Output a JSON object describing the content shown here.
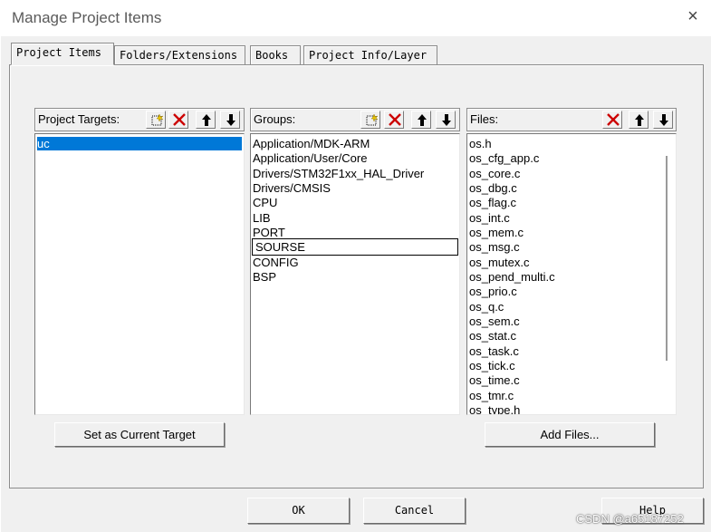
{
  "window": {
    "title": "Manage Project Items",
    "close_symbol": "×"
  },
  "tabs": [
    {
      "label": "Project Items",
      "active": true
    },
    {
      "label": "Folders/Extensions",
      "active": false
    },
    {
      "label": "Books",
      "active": false
    },
    {
      "label": "Project Info/Layer",
      "active": false
    }
  ],
  "targets": {
    "label": "Project Targets:",
    "items": [
      "uc"
    ],
    "selected": 0
  },
  "groups": {
    "label": "Groups:",
    "items": [
      "Application/MDK-ARM",
      "Application/User/Core",
      "Drivers/STM32F1xx_HAL_Driver",
      "Drivers/CMSIS",
      "CPU",
      "LIB",
      "PORT",
      "SOURSE",
      "CONFIG",
      "BSP"
    ],
    "focused": 7
  },
  "files": {
    "label": "Files:",
    "items": [
      "os.h",
      "os_cfg_app.c",
      "os_core.c",
      "os_dbg.c",
      "os_flag.c",
      "os_int.c",
      "os_mem.c",
      "os_msg.c",
      "os_mutex.c",
      "os_pend_multi.c",
      "os_prio.c",
      "os_q.c",
      "os_sem.c",
      "os_stat.c",
      "os_task.c",
      "os_tick.c",
      "os_time.c",
      "os_tmr.c",
      "os_type.h"
    ]
  },
  "buttons": {
    "set_current": "Set as Current Target",
    "add_files": "Add Files...",
    "ok": "OK",
    "cancel": "Cancel",
    "help": "Help"
  },
  "watermark": "CSDN @a65187252",
  "icons": {
    "new": "new-item-icon",
    "delete": "delete-icon",
    "up": "move-up-icon",
    "down": "move-down-icon"
  },
  "colors": {
    "selection": "#0078d7",
    "delete_red": "#cc0000"
  }
}
